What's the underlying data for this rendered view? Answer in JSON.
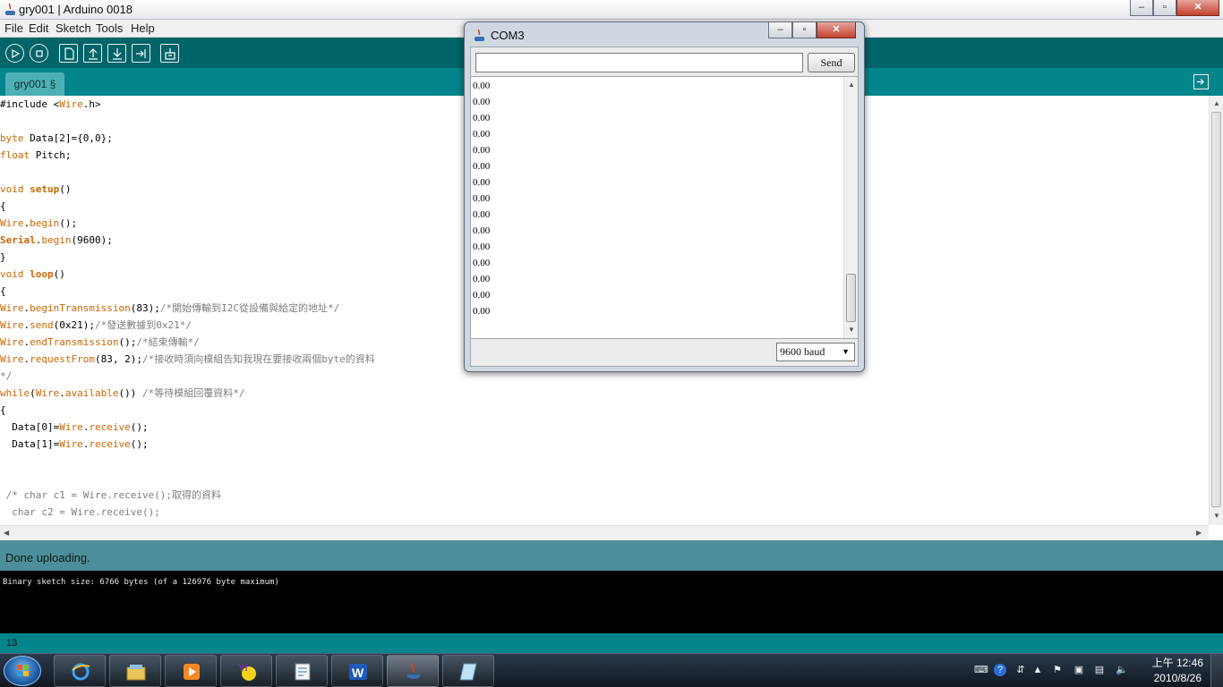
{
  "window": {
    "title": "gry001 | Arduino 0018",
    "controls": {
      "minimize": "–",
      "maximize": "▫",
      "close": "✕"
    }
  },
  "menu": [
    "File",
    "Edit",
    "Sketch",
    "Tools",
    "Help"
  ],
  "toolbar": {
    "buttons": [
      "verify-icon",
      "stop-icon",
      "new-icon",
      "open-icon",
      "save-icon",
      "upload-icon",
      "serial-monitor-icon"
    ]
  },
  "tab": {
    "label": "gry001 §"
  },
  "code": [
    [
      {
        "t": "#include <"
      },
      {
        "t": "Wire",
        "c": "kw"
      },
      {
        "t": ".h>"
      }
    ],
    [],
    [
      {
        "t": "byte",
        "c": "kw"
      },
      {
        "t": " Data[2]={0,0};"
      }
    ],
    [
      {
        "t": "float",
        "c": "kw"
      },
      {
        "t": " Pitch;"
      }
    ],
    [],
    [
      {
        "t": "void",
        "c": "kw"
      },
      {
        "t": " "
      },
      {
        "t": "setup",
        "c": "fn"
      },
      {
        "t": "()"
      }
    ],
    [
      {
        "t": "{"
      }
    ],
    [
      {
        "t": "Wire",
        "c": "kw"
      },
      {
        "t": "."
      },
      {
        "t": "begin",
        "c": "kw"
      },
      {
        "t": "();"
      }
    ],
    [
      {
        "t": "Serial",
        "c": "fn"
      },
      {
        "t": "."
      },
      {
        "t": "begin",
        "c": "kw"
      },
      {
        "t": "(9600);"
      }
    ],
    [
      {
        "t": "}"
      }
    ],
    [
      {
        "t": "void",
        "c": "kw"
      },
      {
        "t": " "
      },
      {
        "t": "loop",
        "c": "fn"
      },
      {
        "t": "()"
      }
    ],
    [
      {
        "t": "{"
      }
    ],
    [
      {
        "t": "Wire",
        "c": "kw"
      },
      {
        "t": "."
      },
      {
        "t": "beginTransmission",
        "c": "kw"
      },
      {
        "t": "(83);"
      },
      {
        "t": "/*開始傳輸到I2C從設備與給定的地址*/",
        "c": "cm"
      }
    ],
    [
      {
        "t": "Wire",
        "c": "kw"
      },
      {
        "t": "."
      },
      {
        "t": "send",
        "c": "kw"
      },
      {
        "t": "(0x21);"
      },
      {
        "t": "/*發送數據到0x21*/",
        "c": "cm"
      }
    ],
    [
      {
        "t": "Wire",
        "c": "kw"
      },
      {
        "t": "."
      },
      {
        "t": "endTransmission",
        "c": "kw"
      },
      {
        "t": "();"
      },
      {
        "t": "/*結束傳輸*/",
        "c": "cm"
      }
    ],
    [
      {
        "t": "Wire",
        "c": "kw"
      },
      {
        "t": "."
      },
      {
        "t": "requestFrom",
        "c": "kw"
      },
      {
        "t": "(83, 2);"
      },
      {
        "t": "/*接收時須向模組告知我現在要接收兩個byte的資料",
        "c": "cm"
      }
    ],
    [
      {
        "t": "*/",
        "c": "cm"
      }
    ],
    [
      {
        "t": "while",
        "c": "kw"
      },
      {
        "t": "("
      },
      {
        "t": "Wire",
        "c": "kw"
      },
      {
        "t": "."
      },
      {
        "t": "available",
        "c": "kw"
      },
      {
        "t": "()) "
      },
      {
        "t": "/*等待模組回覆資料*/",
        "c": "cm"
      }
    ],
    [
      {
        "t": "{"
      }
    ],
    [
      {
        "t": "  Data[0]="
      },
      {
        "t": "Wire",
        "c": "kw"
      },
      {
        "t": "."
      },
      {
        "t": "receive",
        "c": "kw"
      },
      {
        "t": "();"
      }
    ],
    [
      {
        "t": "  Data[1]="
      },
      {
        "t": "Wire",
        "c": "kw"
      },
      {
        "t": "."
      },
      {
        "t": "receive",
        "c": "kw"
      },
      {
        "t": "();"
      }
    ],
    [],
    [],
    [
      {
        "t": " /* char c1 = Wire.receive();取得的資料",
        "c": "cm"
      }
    ],
    [
      {
        "t": "  char c2 = Wire.receive();",
        "c": "cm"
      }
    ]
  ],
  "status": {
    "message": "Done uploading."
  },
  "console": {
    "line": "Binary sketch size: 6766 bytes (of a 126976 byte maximum)"
  },
  "line_number": "13",
  "serial": {
    "title": "COM3",
    "input_value": "",
    "send_label": "Send",
    "output_lines": [
      "0.00",
      "0.00",
      "0.00",
      "0.00",
      "0.00",
      "0.00",
      "0.00",
      "0.00",
      "0.00",
      "0.00",
      "0.00",
      "0.00",
      "0.00",
      "0.00",
      "0.00"
    ],
    "baud": "9600 baud"
  },
  "taskbar": {
    "items": [
      "internet-explorer-icon",
      "file-explorer-icon",
      "media-player-icon",
      "yahoo-messenger-icon",
      "text-editor-icon",
      "word-icon",
      "java-icon",
      "notepad-icon"
    ],
    "clock": {
      "time": "上午 12:46",
      "date": "2010/8/26"
    }
  }
}
